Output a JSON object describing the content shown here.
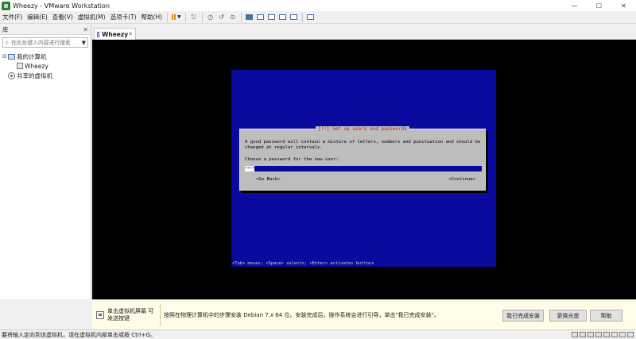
{
  "window": {
    "title": "Wheezy - VMware Workstation",
    "minimize": "—",
    "maximize": "☐",
    "close": "✕"
  },
  "menu": [
    "文件(F)",
    "编辑(E)",
    "查看(V)",
    "虚拟机(M)",
    "选项卡(T)",
    "帮助(H)"
  ],
  "library": {
    "title": "库",
    "close": "✕",
    "search_placeholder": "在此处键入内容进行搜索",
    "my_computer": "我的计算机",
    "vm_name": "Wheezy",
    "shared_vms": "共享的虚拟机"
  },
  "tab": {
    "label": "Wheezy",
    "close": "✕"
  },
  "installer": {
    "dialog_title": "[!!] Set up users and passwords",
    "body": "A good password will contain a mixture of letters, numbers and punctuation and should be changed at regular intervals.",
    "prompt": "Choose a password for the new user:",
    "field_value": "****",
    "go_back": "<Go Back>",
    "continue": "<Continue>",
    "help_line": "<Tab> moves; <Space> selects; <Enter> activates buttons"
  },
  "hint": {
    "left": "单击虚拟机屏幕 可发送按键",
    "message": "按照在物理计算机中的步骤安装 Debian 7.x 64 位。安装完成后，操作系统会进行引导，单击\"我已完成安装\"。",
    "done_button": "我已完成安装",
    "change_disc_button": "更换光盘",
    "help_button": "帮助"
  },
  "status": {
    "text": "要将输入定向到该虚拟机，请在虚拟机内部单击或按 Ctrl+G。"
  },
  "colors": {
    "installer_blue": "#0a0a9e",
    "dialog_grey": "#bdbdbd",
    "title_red": "#c41e1e",
    "hint_yellow": "#fffde7"
  }
}
